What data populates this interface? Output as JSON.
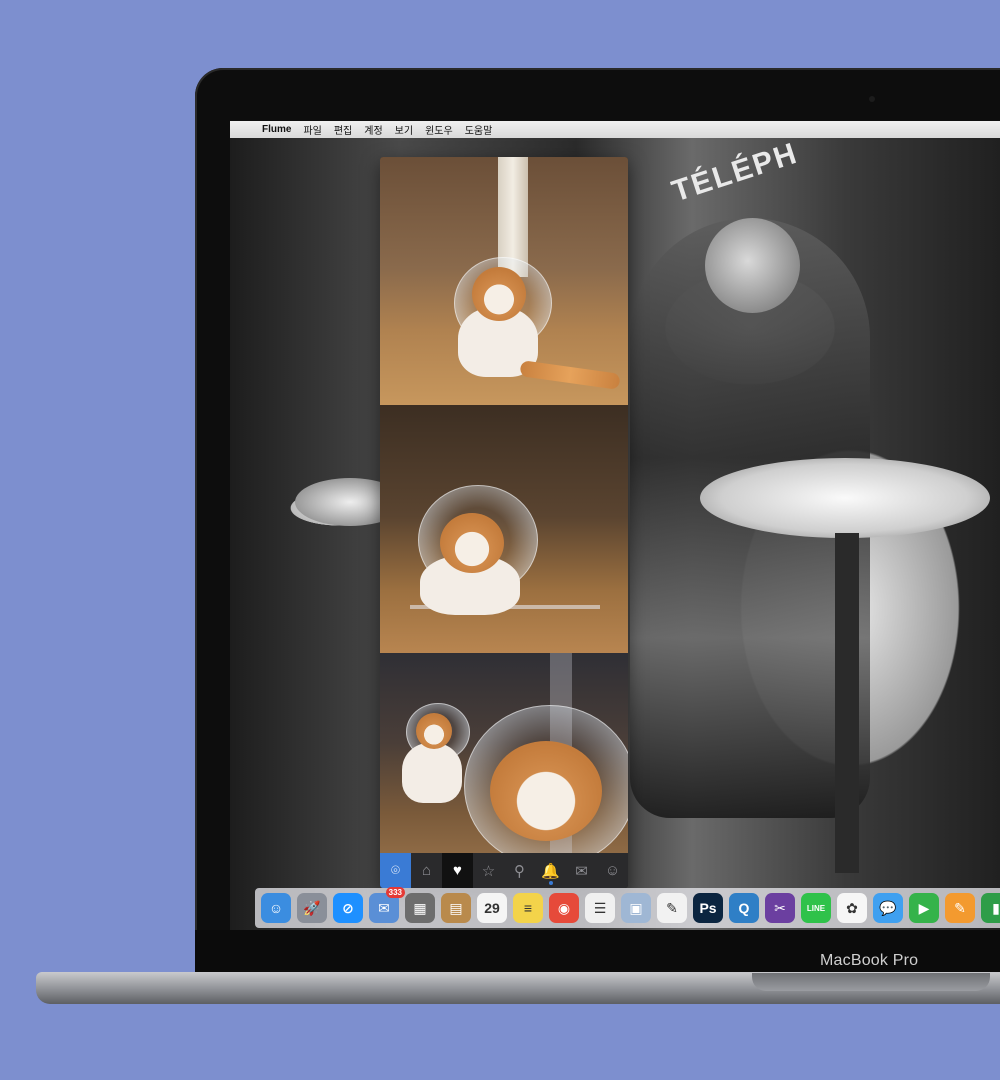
{
  "laptop": {
    "brand": "MacBook Pro"
  },
  "menubar": {
    "apple": "",
    "app_name": "Flume",
    "items": [
      "파일",
      "편집",
      "계정",
      "보기",
      "윈도우",
      "도움말"
    ]
  },
  "desktop": {
    "sign_text": "TÉLÉPH"
  },
  "flume": {
    "photos": [
      "cat-photo-1",
      "cat-photo-2",
      "cat-photo-3"
    ],
    "tabs": [
      {
        "name": "camera",
        "glyph": "⌾"
      },
      {
        "name": "home",
        "glyph": "⌂"
      },
      {
        "name": "likes",
        "glyph": "♥"
      },
      {
        "name": "favorites",
        "glyph": "☆"
      },
      {
        "name": "search",
        "glyph": "⚲"
      },
      {
        "name": "notifications",
        "glyph": "🔔"
      },
      {
        "name": "direct",
        "glyph": "✉"
      },
      {
        "name": "profile",
        "glyph": "☺"
      }
    ]
  },
  "dock": {
    "icons": [
      {
        "name": "finder",
        "glyph": "☺",
        "color": "#3b8de0"
      },
      {
        "name": "launchpad",
        "glyph": "🚀",
        "color": "#8a8f99"
      },
      {
        "name": "safari",
        "glyph": "⊘",
        "color": "#1e90ff"
      },
      {
        "name": "mail",
        "glyph": "✉",
        "color": "#5a8fd6",
        "badge": "333"
      },
      {
        "name": "calculator",
        "glyph": "▦",
        "color": "#6d6d6d"
      },
      {
        "name": "contacts",
        "glyph": "▤",
        "color": "#b98a4c"
      },
      {
        "name": "calendar",
        "glyph": "29",
        "color": "#f5f5f5"
      },
      {
        "name": "notes",
        "glyph": "≡",
        "color": "#f3d34a"
      },
      {
        "name": "chrome",
        "glyph": "◉",
        "color": "#e64a3a"
      },
      {
        "name": "reminders",
        "glyph": "☰",
        "color": "#f0f0f0"
      },
      {
        "name": "preview",
        "glyph": "▣",
        "color": "#9fb7d4"
      },
      {
        "name": "textedit",
        "glyph": "✎",
        "color": "#f2f2f2"
      },
      {
        "name": "photoshop",
        "glyph": "Ps",
        "color": "#0b2540"
      },
      {
        "name": "qreader",
        "glyph": "Q",
        "color": "#2f7fc6"
      },
      {
        "name": "final-cut",
        "glyph": "✂",
        "color": "#6b3fa0"
      },
      {
        "name": "line",
        "glyph": "LINE",
        "color": "#2fc24a"
      },
      {
        "name": "photos",
        "glyph": "✿",
        "color": "#f6f6f6"
      },
      {
        "name": "messages",
        "glyph": "💬",
        "color": "#3fa0f0"
      },
      {
        "name": "facetime",
        "glyph": "▶",
        "color": "#35b34a"
      },
      {
        "name": "pages",
        "glyph": "✎",
        "color": "#f39a2f"
      },
      {
        "name": "numbers",
        "glyph": "▮",
        "color": "#2e9d48"
      },
      {
        "name": "keynote",
        "glyph": "◆",
        "color": "#3c7fd8"
      }
    ]
  }
}
